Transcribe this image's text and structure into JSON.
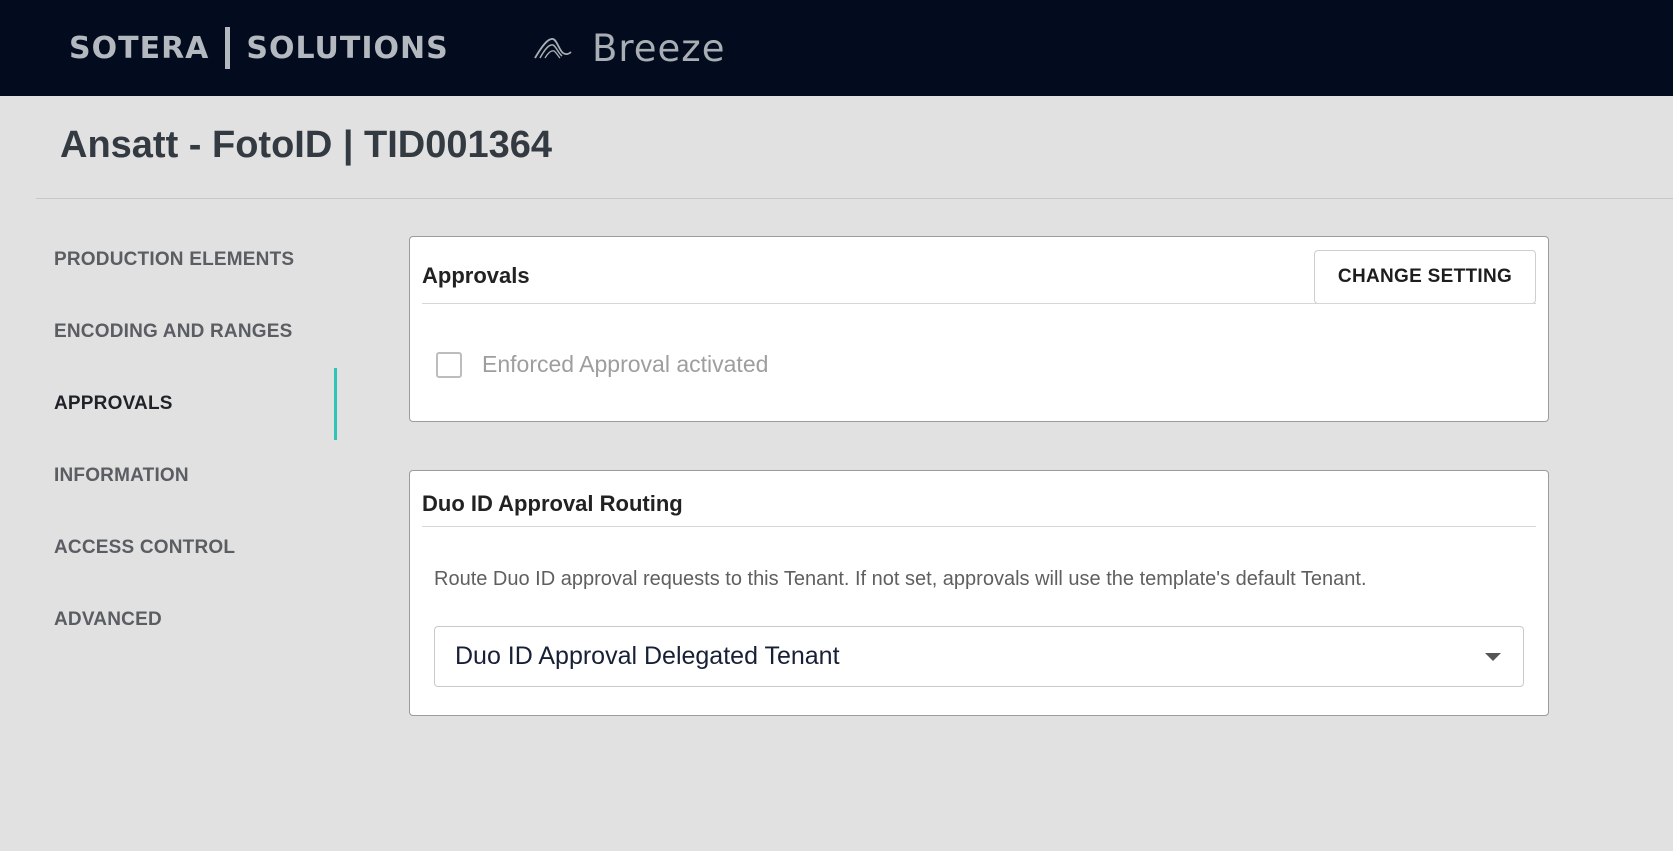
{
  "header": {
    "brand_left": "SOTERA",
    "brand_right": "SOLUTIONS",
    "product_name": "Breeze",
    "product_icon": "breeze-wave-logo"
  },
  "page": {
    "title": "Ansatt - FotoID | TID001364"
  },
  "sidebar": {
    "items": [
      {
        "label": "PRODUCTION ELEMENTS",
        "active": false
      },
      {
        "label": "ENCODING AND RANGES",
        "active": false
      },
      {
        "label": "APPROVALS",
        "active": true
      },
      {
        "label": "INFORMATION",
        "active": false
      },
      {
        "label": "ACCESS CONTROL",
        "active": false
      },
      {
        "label": "ADVANCED",
        "active": false
      }
    ],
    "indicator_color": "#2ec4b6"
  },
  "approvals_card": {
    "title": "Approvals",
    "change_button_label": "CHANGE SETTING",
    "checkbox_label": "Enforced Approval activated",
    "checkbox_checked": false
  },
  "routing_card": {
    "title": "Duo ID Approval Routing",
    "description": "Route Duo ID approval requests to this Tenant. If not set, approvals will use the template's default Tenant.",
    "select_value": "Duo ID Approval Delegated Tenant"
  },
  "colors": {
    "topbar": "#020c1e",
    "background": "#e1e1e1",
    "accent": "#2ec4b6"
  }
}
